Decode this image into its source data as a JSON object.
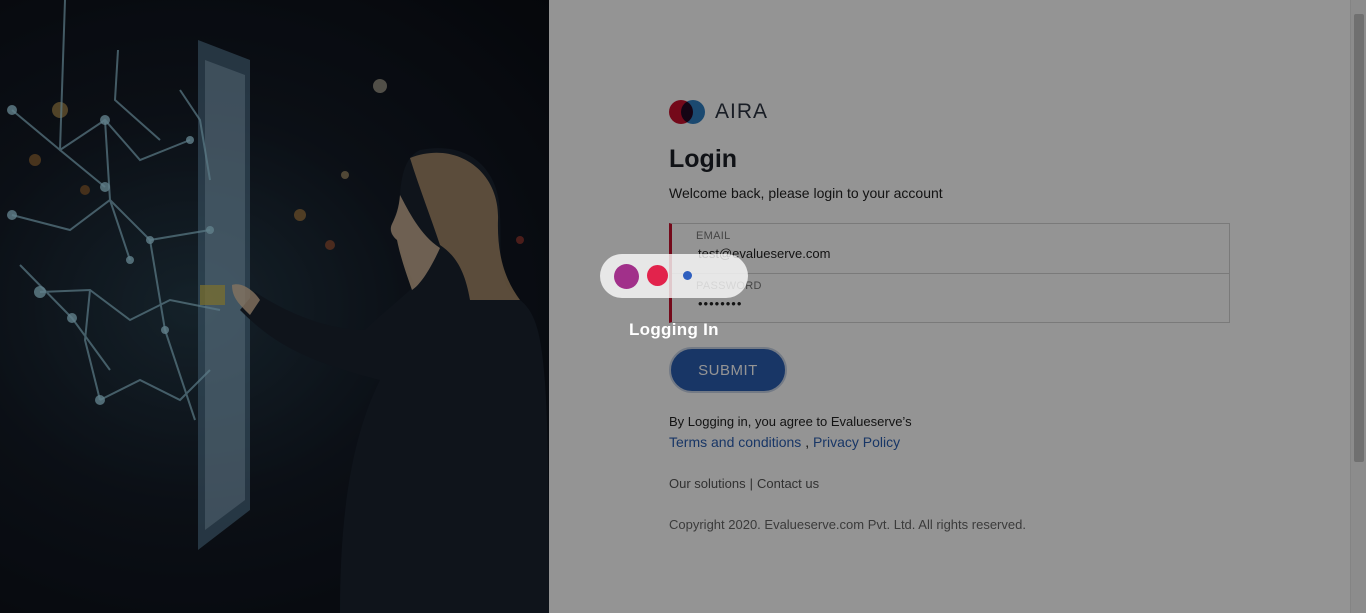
{
  "brand": {
    "name": "AIRA"
  },
  "login": {
    "title": "Login",
    "welcome": "Welcome back, please login to your account",
    "email_label": "EMAIL",
    "email_value": "test@evalueserve.com",
    "password_label": "PASSWORD",
    "password_value": "••••••••",
    "submit_label": "SUBMIT"
  },
  "legal": {
    "agree_text": "By Logging in, you agree to Evalueserve’s",
    "terms_label": "Terms and conditions",
    "separator": ",",
    "privacy_label": "Privacy Policy"
  },
  "footer": {
    "solutions_label": "Our solutions",
    "divider": "|",
    "contact_label": "Contact us",
    "copyright": "Copyright 2020. Evalueserve.com Pvt. Ltd. All rights reserved."
  },
  "loading": {
    "text": "Logging In"
  },
  "colors": {
    "brand_red": "#c8102e",
    "brand_blue": "#2f7fc1",
    "button_blue": "#2a5db0",
    "loader_purple": "#a1308a",
    "loader_pink": "#e2234c",
    "loader_blue": "#2f5fbf"
  }
}
